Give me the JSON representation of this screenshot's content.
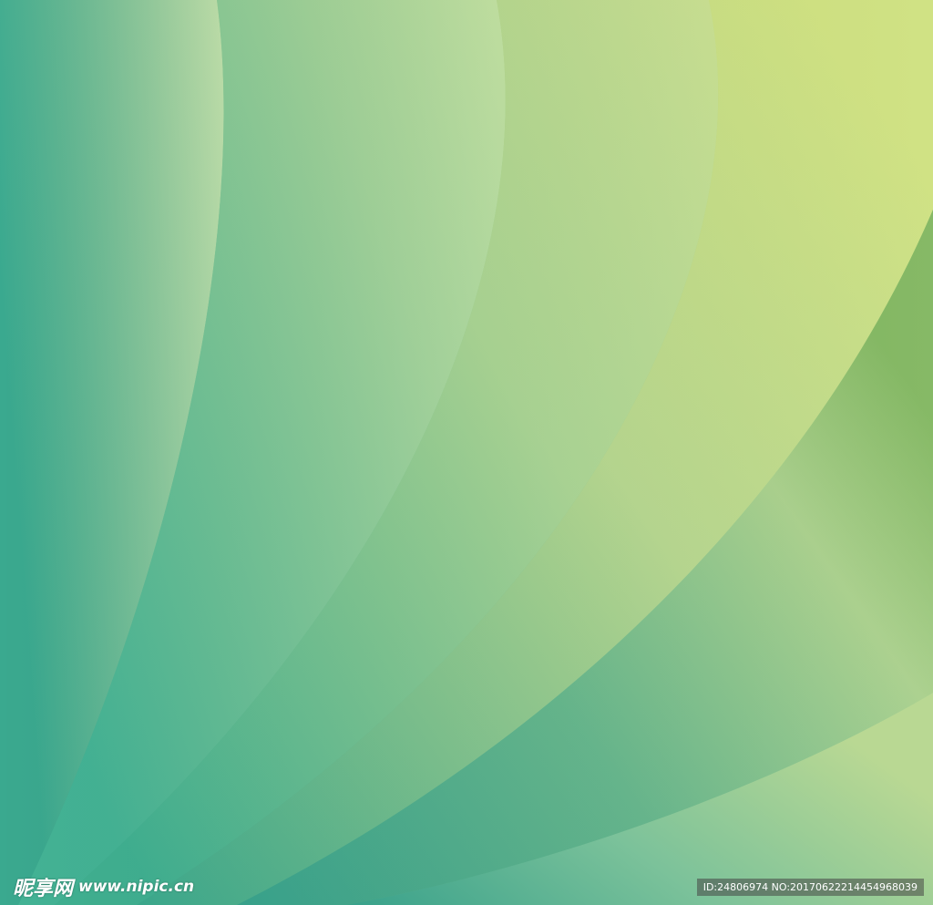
{
  "watermark": {
    "brand": "昵享网",
    "site": "www.nipic.cn"
  },
  "image_id": "ID:24806974 NO:20170622214454968039",
  "colors": {
    "teal": "#2f9e88",
    "mint": "#5fbf98",
    "pale_green": "#b6d697",
    "lime": "#cfe07a",
    "leaf_green": "#7ab45a"
  }
}
